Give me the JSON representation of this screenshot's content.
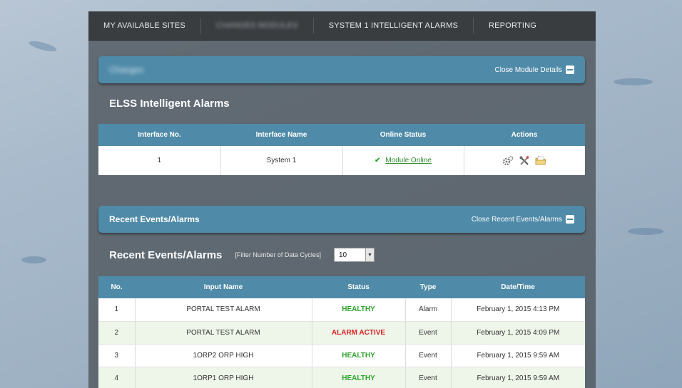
{
  "nav": {
    "items": [
      {
        "label": "MY AVAILABLE SITES",
        "blurred": false
      },
      {
        "label": "CHANGES MODULES",
        "blurred": true
      },
      {
        "label": "SYSTEM 1 INTELLIGENT ALARMS",
        "blurred": false
      },
      {
        "label": "REPORTING",
        "blurred": false
      }
    ]
  },
  "module_panel": {
    "title": "Changes",
    "close_label": "Close Module Details"
  },
  "alarms_section": {
    "title": "ELSS Intelligent Alarms",
    "columns": [
      "Interface No.",
      "Interface Name",
      "Online Status",
      "Actions"
    ],
    "rows": [
      {
        "no": "1",
        "name": "System 1",
        "status": "Module Online",
        "actions": [
          "gears-icon",
          "tools-icon",
          "folder-icon"
        ]
      }
    ]
  },
  "events_panel": {
    "title": "Recent Events/Alarms",
    "close_label": "Close Recent Events/Alarms"
  },
  "events_section": {
    "title": "Recent Events/Alarms",
    "filter_label": "[Filter Number of Data Cycles]",
    "filter_value": "10",
    "columns": [
      "No.",
      "Input Name",
      "Status",
      "Type",
      "Date/Time"
    ],
    "rows": [
      {
        "no": "1",
        "input": "PORTAL TEST ALARM",
        "status": "HEALTHY",
        "type": "Alarm",
        "datetime": "February 1, 2015 4:13 PM"
      },
      {
        "no": "2",
        "input": "PORTAL TEST ALARM",
        "status": "ALARM ACTIVE",
        "type": "Event",
        "datetime": "February 1, 2015 4:09 PM"
      },
      {
        "no": "3",
        "input": "1ORP2 ORP HIGH",
        "status": "HEALTHY",
        "type": "Event",
        "datetime": "February 1, 2015 9:59 AM"
      },
      {
        "no": "4",
        "input": "1ORP1 ORP HIGH",
        "status": "HEALTHY",
        "type": "Event",
        "datetime": "February 1, 2015 9:59 AM"
      }
    ]
  },
  "colors": {
    "header_blue": "#4f8aa8",
    "healthy_green": "#2ea52e",
    "alarm_red": "#d92323"
  }
}
